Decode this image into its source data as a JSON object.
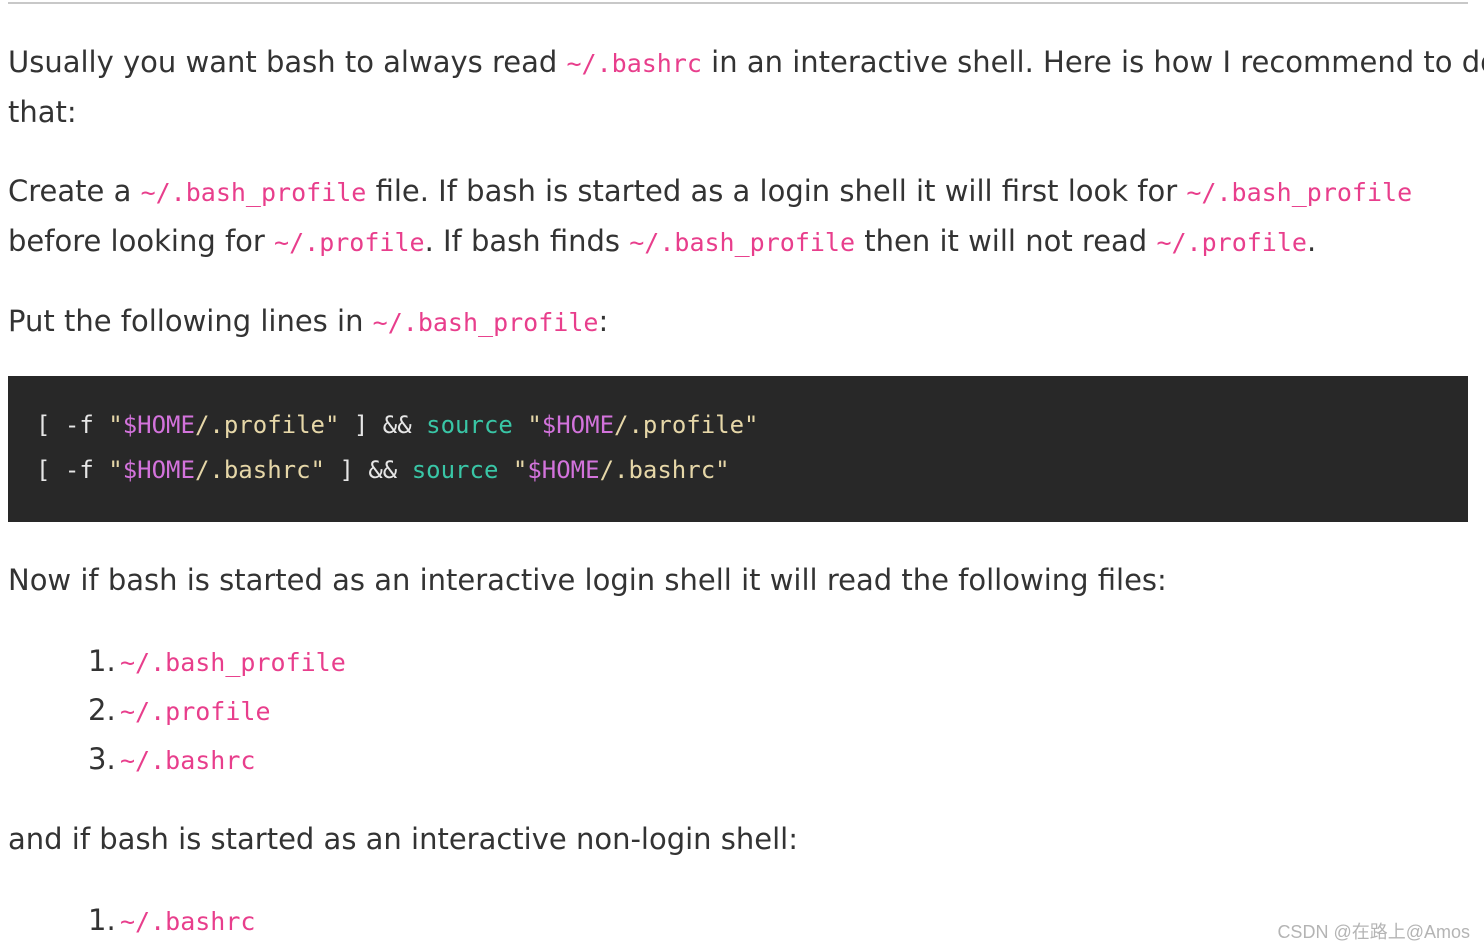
{
  "paragraphs": {
    "p1": {
      "t1": "Usually you want bash to always read ",
      "c1": "~/.bashrc",
      "t2": " in an interactive shell. Here is how I recommend to do",
      "line2": "that:"
    },
    "p2": {
      "t1": "Create a ",
      "c1": "~/.bash_profile",
      "t2": " file. If bash is started as a login shell it will first look for ",
      "c2": "~/.bash_profile",
      "t3": "before looking for ",
      "c3": "~/.profile",
      "t4": ". If bash finds ",
      "c4": "~/.bash_profile",
      "t5": " then it will not read ",
      "c5": "~/.profile",
      "t6": "."
    },
    "p3": {
      "t1": "Put the following lines in ",
      "c1": "~/.bash_profile",
      "t2": ":"
    },
    "p4": "Now if bash is started as an interactive login shell it will read the following files:",
    "p5": "and if bash is started as an interactive non-login shell:"
  },
  "code_block": {
    "line1": {
      "bracket_open": "[ -f ",
      "q1": "\"",
      "var1": "$HOME",
      "path1": "/.profile\"",
      "bracket_close": " ] && ",
      "kw": "source",
      "space": " ",
      "q2": "\"",
      "var2": "$HOME",
      "path2": "/.profile\""
    },
    "line2": {
      "bracket_open": "[ -f ",
      "q1": "\"",
      "var1": "$HOME",
      "path1": "/.bashrc\"",
      "bracket_close": " ] && ",
      "kw": "source",
      "space": " ",
      "q2": "\"",
      "var2": "$HOME",
      "path2": "/.bashrc\""
    }
  },
  "login_list": [
    {
      "num": "1.",
      "file": "~/.bash_profile"
    },
    {
      "num": "2.",
      "file": "~/.profile"
    },
    {
      "num": "3.",
      "file": "~/.bashrc"
    }
  ],
  "nonlogin_list": [
    {
      "num": "1.",
      "file": "~/.bashrc"
    }
  ],
  "watermark": "CSDN @在路上@Amos",
  "colors": {
    "text": "#333333",
    "inline_code": "#e83e8c",
    "code_bg": "#282828",
    "code_string": "#e6d7a8",
    "code_variable": "#d373dc",
    "code_keyword": "#39c6a6"
  }
}
